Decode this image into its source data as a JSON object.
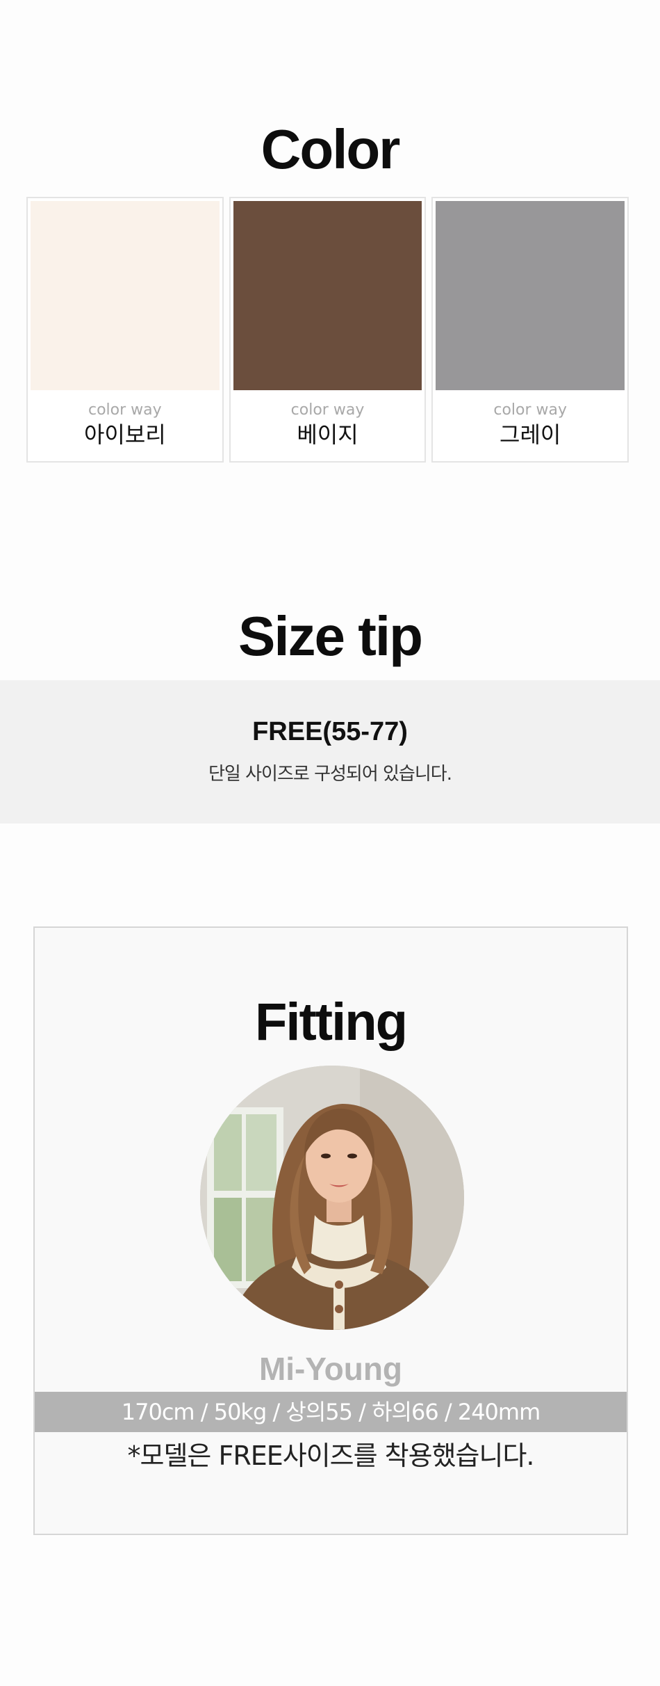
{
  "color_section": {
    "title": "Color",
    "swatches": [
      {
        "caption": "color way",
        "name": "아이보리",
        "color": "#faf2ea"
      },
      {
        "caption": "color way",
        "name": "베이지",
        "color": "#6b4e3d"
      },
      {
        "caption": "color way",
        "name": "그레이",
        "color": "#989799"
      }
    ]
  },
  "size_section": {
    "title": "Size tip",
    "size": "FREE(55-77)",
    "description": "단일 사이즈로 구성되어 있습니다."
  },
  "fitting_section": {
    "title": "Fitting",
    "model_name": "Mi-Young",
    "stats": "170cm / 50kg / 상의55 / 하의66 / 240mm",
    "note": "*모델은 FREE사이즈를 착용했습니다."
  }
}
